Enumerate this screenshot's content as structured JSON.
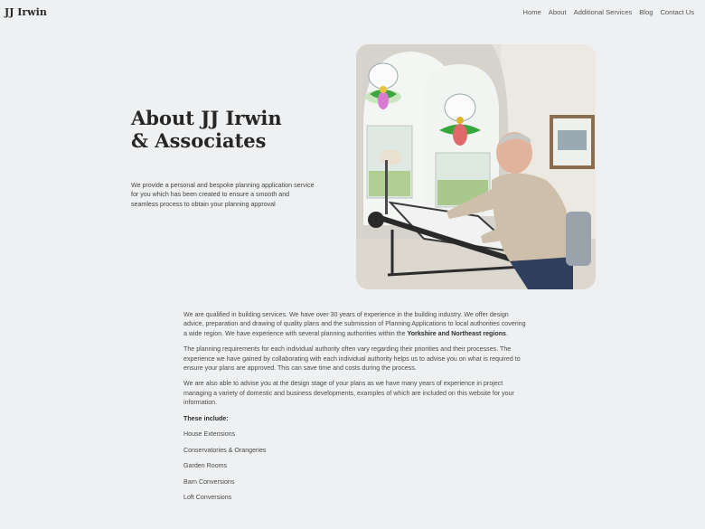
{
  "brand": "JJ Irwin",
  "nav": [
    "Home",
    "About",
    "Additional Services",
    "Blog",
    "Contact Us"
  ],
  "hero": {
    "title": "About JJ Irwin & Associates",
    "subtitle": "We provide a personal and bespoke planning application service for you which has been created to ensure a smooth and seamless process to obtain your planning approval"
  },
  "content": {
    "p1_before": "We are qualified in building services. We have over 30 years of experience in the building industry. We offer design advice, preparation and drawing of quality plans and the submission of Planning Applications to local authorities covering a wide region. We have experience with several planning authorities within the ",
    "p1_bold": "Yorkshire and Northeast regions",
    "p1_after": ".",
    "p2": "The planning requirements for each individual authority often vary regarding their priorities and their processes. The experience we have gained by collaborating with each individual authority helps us to advise you on what is required to ensure your plans are approved. This can save time and costs during the process.",
    "p3": "We are also able to advise you at the design stage of your plans as we have many years of experience in project managing a variety of domestic and business developments, examples of which are included on this website for your information.",
    "list_heading": "These include:",
    "list": [
      "House Extensions",
      "Conservatories & Orangeries",
      "Garden Rooms",
      "Barn Conversions",
      "Loft Conversions"
    ]
  }
}
